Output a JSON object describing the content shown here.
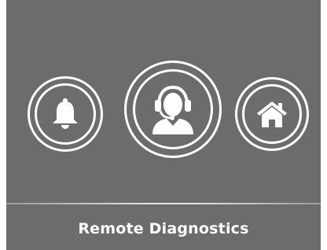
{
  "screen": {
    "title": "Remote Diagnostics",
    "background_color": "#6c6c6c",
    "foreground_color": "#ffffff"
  },
  "buttons": [
    {
      "icon": "bell-icon",
      "role": "notifications"
    },
    {
      "icon": "support-agent-icon",
      "role": "remote-diagnostics",
      "selected": true
    },
    {
      "icon": "home-icon",
      "role": "home"
    }
  ]
}
